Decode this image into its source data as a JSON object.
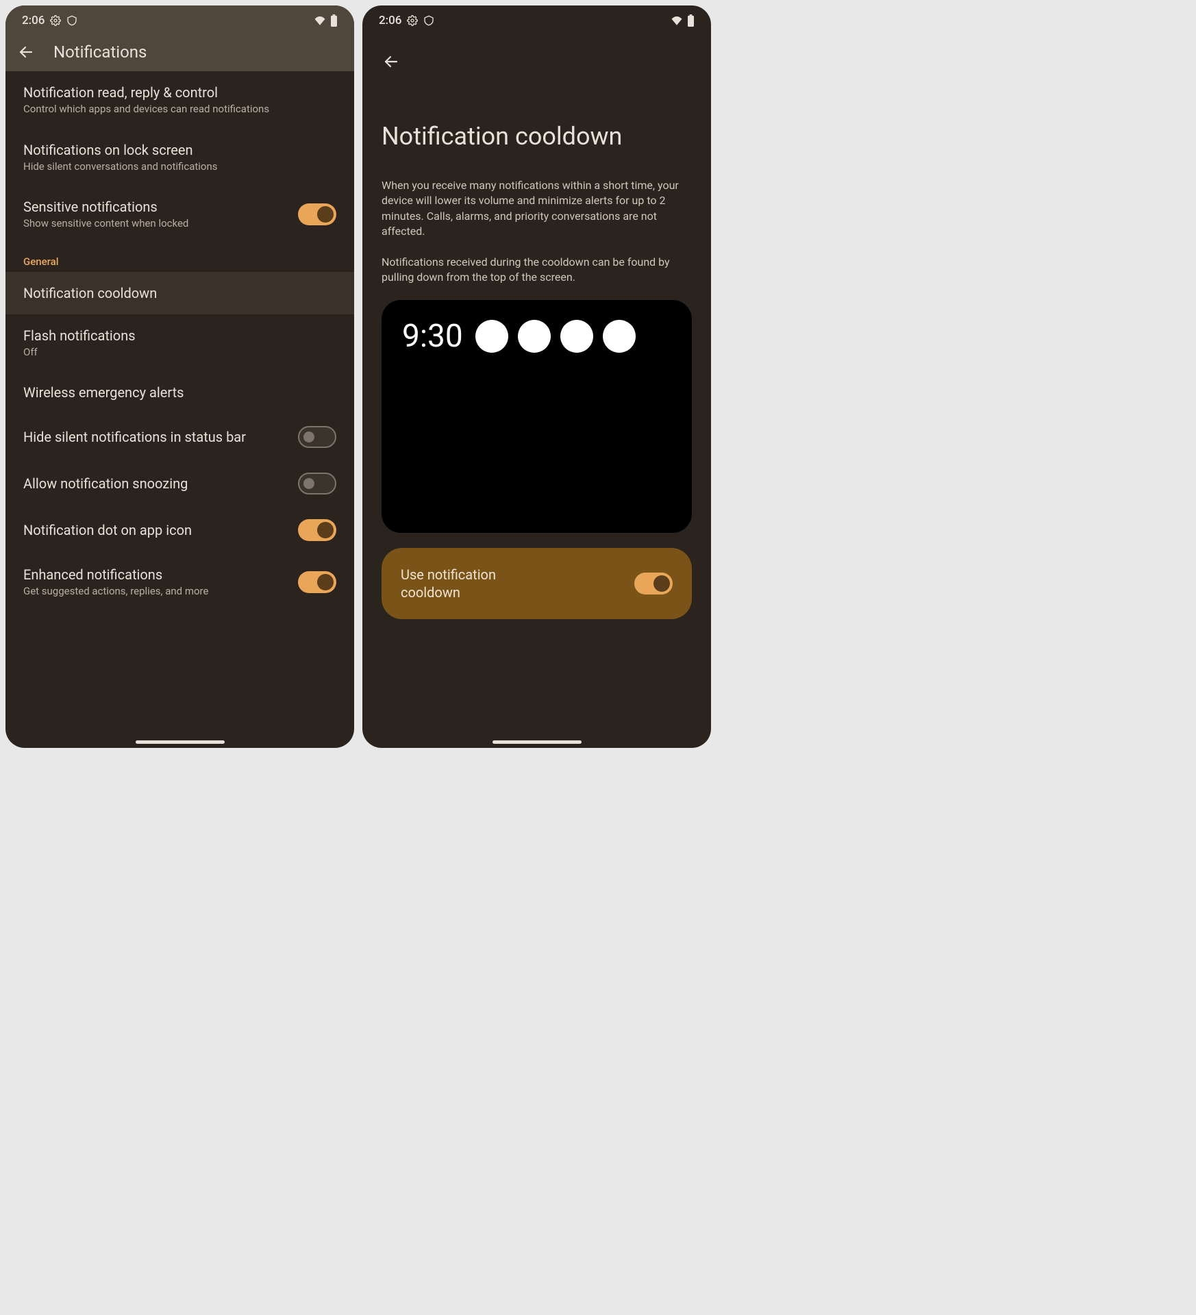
{
  "status": {
    "time": "2:06"
  },
  "left": {
    "title": "Notifications",
    "items": [
      {
        "title": "Notification read, reply & control",
        "sub": "Control which apps and devices can read notifications",
        "toggle": null
      },
      {
        "title": "Notifications on lock screen",
        "sub": "Hide silent conversations and notifications",
        "toggle": null
      },
      {
        "title": "Sensitive notifications",
        "sub": "Show sensitive content when locked",
        "toggle": "on"
      }
    ],
    "section_header": "General",
    "general": [
      {
        "title": "Notification cooldown",
        "sub": "",
        "toggle": null,
        "highlighted": true
      },
      {
        "title": "Flash notifications",
        "sub": "Off",
        "toggle": null
      },
      {
        "title": "Wireless emergency alerts",
        "sub": "",
        "toggle": null
      },
      {
        "title": "Hide silent notifications in status bar",
        "sub": "",
        "toggle": "off"
      },
      {
        "title": "Allow notification snoozing",
        "sub": "",
        "toggle": "off"
      },
      {
        "title": "Notification dot on app icon",
        "sub": "",
        "toggle": "on"
      },
      {
        "title": "Enhanced notifications",
        "sub": "Get suggested actions, replies, and more",
        "toggle": "on"
      }
    ]
  },
  "right": {
    "title": "Notification cooldown",
    "desc1": "When you receive many notifications within a short time, your device will lower its volume and minimize alerts for up to 2 minutes. Calls, alarms, and priority conversations are not affected.",
    "desc2": "Notifications received during the cooldown can be found by pulling down from the top of the screen.",
    "preview_time": "9:30",
    "toggle_label": "Use notification cooldown"
  }
}
